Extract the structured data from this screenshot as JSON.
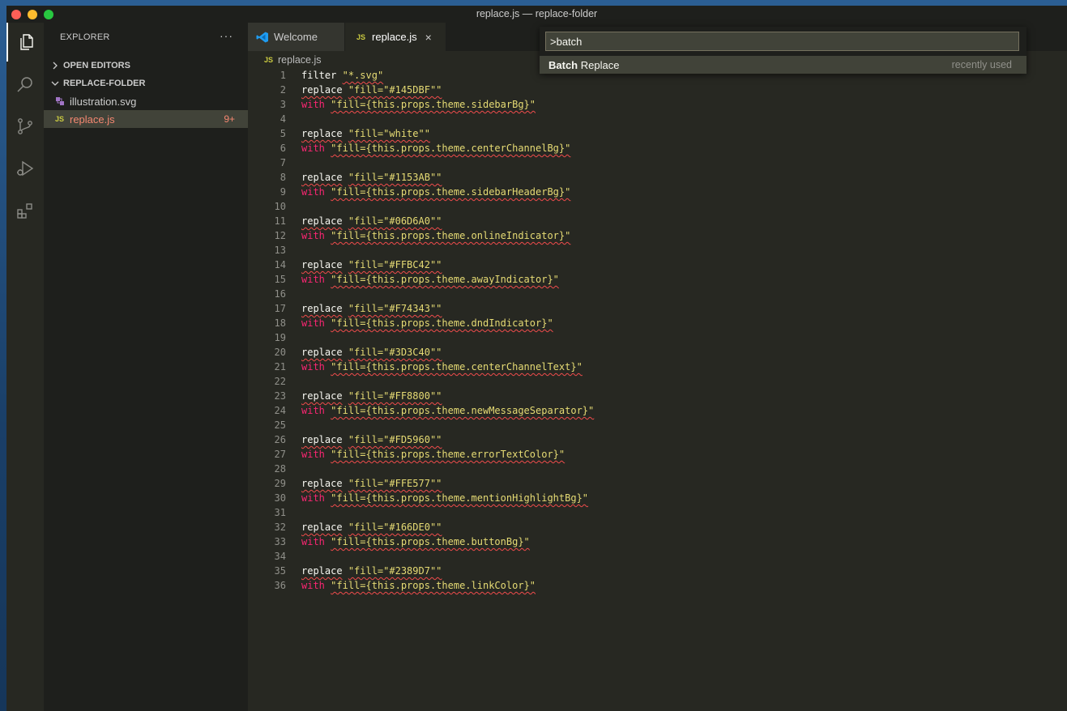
{
  "window": {
    "title": "replace.js — replace-folder"
  },
  "sidebar": {
    "header": "EXPLORER",
    "more": "···",
    "sections": {
      "open_editors": "OPEN EDITORS",
      "folder": "REPLACE-FOLDER"
    },
    "files": [
      {
        "name": "illustration.svg",
        "badge": ""
      },
      {
        "name": "replace.js",
        "badge": "9+",
        "icon": "JS"
      }
    ]
  },
  "tabs": [
    {
      "label": "Welcome"
    },
    {
      "label": "replace.js",
      "icon": "JS",
      "close": "×"
    }
  ],
  "breadcrumb": {
    "icon": "JS",
    "file": "replace.js"
  },
  "palette": {
    "input_value": ">batch",
    "result": {
      "highlight": "Batch",
      "rest": " Replace",
      "hint": "recently used"
    }
  },
  "code": {
    "line_numbers": [
      "1",
      "2",
      "3",
      "4",
      "5",
      "6",
      "7",
      "8",
      "9",
      "10",
      "11",
      "12",
      "13",
      "14",
      "15",
      "16",
      "17",
      "18",
      "19",
      "20",
      "21",
      "22",
      "23",
      "24",
      "25",
      "26",
      "27",
      "28",
      "29",
      "30",
      "31",
      "32",
      "33",
      "34",
      "35",
      "36"
    ],
    "filter": {
      "keyword": "filter",
      "value": "\"*.svg\""
    },
    "pairs": [
      {
        "replace_kw": "replace",
        "replace_val": "\"fill=\"#145DBF\"\"",
        "with_kw": "with",
        "with_val": "\"fill={this.props.theme.sidebarBg}\""
      },
      {
        "replace_kw": "replace",
        "replace_val": "\"fill=\"white\"\"",
        "with_kw": "with",
        "with_val": "\"fill={this.props.theme.centerChannelBg}\""
      },
      {
        "replace_kw": "replace",
        "replace_val": "\"fill=\"#1153AB\"\"",
        "with_kw": "with",
        "with_val": "\"fill={this.props.theme.sidebarHeaderBg}\""
      },
      {
        "replace_kw": "replace",
        "replace_val": "\"fill=\"#06D6A0\"\"",
        "with_kw": "with",
        "with_val": "\"fill={this.props.theme.onlineIndicator}\""
      },
      {
        "replace_kw": "replace",
        "replace_val": "\"fill=\"#FFBC42\"\"",
        "with_kw": "with",
        "with_val": "\"fill={this.props.theme.awayIndicator}\""
      },
      {
        "replace_kw": "replace",
        "replace_val": "\"fill=\"#F74343\"\"",
        "with_kw": "with",
        "with_val": "\"fill={this.props.theme.dndIndicator}\""
      },
      {
        "replace_kw": "replace",
        "replace_val": "\"fill=\"#3D3C40\"\"",
        "with_kw": "with",
        "with_val": "\"fill={this.props.theme.centerChannelText}\""
      },
      {
        "replace_kw": "replace",
        "replace_val": "\"fill=\"#FF8800\"\"",
        "with_kw": "with",
        "with_val": "\"fill={this.props.theme.newMessageSeparator}\""
      },
      {
        "replace_kw": "replace",
        "replace_val": "\"fill=\"#FD5960\"\"",
        "with_kw": "with",
        "with_val": "\"fill={this.props.theme.errorTextColor}\""
      },
      {
        "replace_kw": "replace",
        "replace_val": "\"fill=\"#FFE577\"\"",
        "with_kw": "with",
        "with_val": "\"fill={this.props.theme.mentionHighlightBg}\""
      },
      {
        "replace_kw": "replace",
        "replace_val": "\"fill=\"#166DE0\"\"",
        "with_kw": "with",
        "with_val": "\"fill={this.props.theme.buttonBg}\""
      },
      {
        "replace_kw": "replace",
        "replace_val": "\"fill=\"#2389D7\"\"",
        "with_kw": "with",
        "with_val": "\"fill={this.props.theme.linkColor}\""
      }
    ]
  },
  "colors": {
    "accent_vscode": "#007acc",
    "monokai_bg": "#272822",
    "string": "#e6db74",
    "keyword": "#f92672"
  },
  "icons": [
    "files-icon",
    "search-icon",
    "source-control-icon",
    "run-debug-icon",
    "extensions-icon",
    "vscode-logo-icon",
    "svg-file-icon",
    "chevron-right-icon",
    "chevron-down-icon"
  ]
}
